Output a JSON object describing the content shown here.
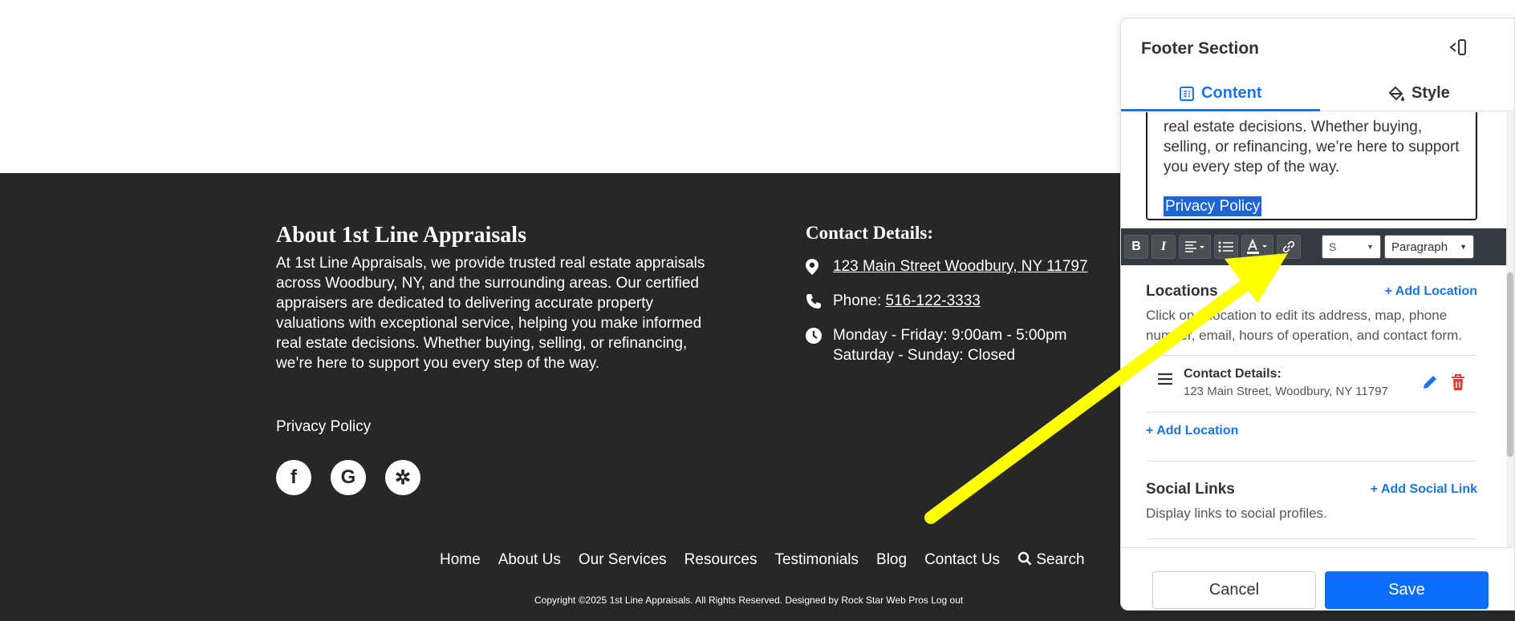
{
  "footer": {
    "about_title": "About 1st Line Appraisals",
    "about_text": "At 1st Line Appraisals, we provide trusted real estate appraisals across Woodbury, NY, and the surrounding areas. Our certified appraisers are dedicated to delivering accurate property valuations with exceptional service, helping you make informed real estate decisions. Whether buying, selling, or refinancing, we’re here to support you every step of the way.",
    "privacy": "Privacy Policy",
    "contact_title": "Contact Details:",
    "address": "123 Main Street Woodbury, NY 11797",
    "phone_label": "Phone: ",
    "phone": "516-122-3333",
    "hours_weekday": "Monday - Friday: 9:00am - 5:00pm",
    "hours_weekend": "Saturday - Sunday: Closed",
    "nav": [
      "Home",
      "About Us",
      "Our Services",
      "Resources",
      "Testimonials",
      "Blog",
      "Contact Us",
      "Search"
    ],
    "copyright": "Copyright ©2025 1st Line Appraisals. All Rights Reserved. Designed by Rock Star Web Pros Log out",
    "social_icons": [
      "facebook-icon",
      "google-icon",
      "yelp-icon"
    ]
  },
  "panel": {
    "title": "Footer Section",
    "tabs": [
      "Content",
      "Style"
    ],
    "editor_text": "real estate decisions. Whether buying, selling, or refinancing, we’re here to support you every step of the way.",
    "editor_selected": "Privacy Policy",
    "toolbar": {
      "bold": "B",
      "italic": "I",
      "size_select": "S",
      "format_select": "Paragraph"
    },
    "locations": {
      "title": "Locations",
      "add_label": "+ Add Location",
      "description": "Click on a location to edit its address, map, phone number, email, hours of operation, and contact form.",
      "item_name": "Contact Details:",
      "item_address": "123 Main Street, Woodbury, NY 11797",
      "add_label_bottom": "+ Add Location"
    },
    "social": {
      "title": "Social Links",
      "add_label": "+ Add Social Link",
      "description": "Display links to social profiles."
    },
    "cancel_label": "Cancel",
    "save_label": "Save"
  },
  "colors": {
    "footer_bg": "#272727",
    "accent": "#1a73e8",
    "save": "#0d6efd",
    "arrow": "#ffff00",
    "delete": "#e53935"
  }
}
